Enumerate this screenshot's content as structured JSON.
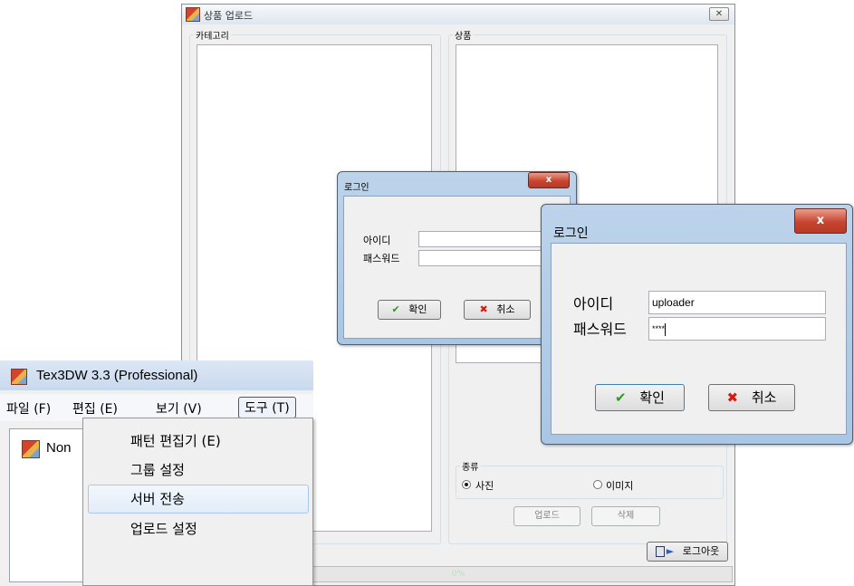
{
  "upload_window": {
    "title": "상품 업로드",
    "close_glyph": "✕",
    "category_label": "카테고리",
    "product_label": "상품",
    "type_group_label": "종류",
    "type_options": [
      "사진",
      "이미지"
    ],
    "type_selected": "사진",
    "upload_button": "업로드",
    "delete_button": "삭제",
    "logout_button": "로그아웃",
    "progress_text": "0%"
  },
  "login_small": {
    "title": "로그인",
    "id_label": "아이디",
    "pw_label": "패스워드",
    "ok_button": "확인",
    "cancel_button": "취소",
    "close_glyph": "x"
  },
  "login_large": {
    "title": "로그인",
    "id_label": "아이디",
    "id_value": "uploader",
    "pw_label": "패스워드",
    "pw_value": "****",
    "ok_button": "확인",
    "cancel_button": "취소",
    "close_glyph": "x"
  },
  "tex_app": {
    "title": "Tex3DW 3.3 (Professional)",
    "menu": [
      "파일 (F)",
      "편집 (E)",
      "보기 (V)",
      "도구 (T)"
    ],
    "active_menu": "도구 (T)",
    "tab_label": "Non",
    "tools_menu_items": [
      "패턴 편집기 (E)",
      "그룹 설정",
      "서버 전송",
      "업로드 설정"
    ],
    "highlighted_item": "서버 전송"
  },
  "colors": {
    "window_bg": "#f0f0f0",
    "dialog_frame": "#b4cde7",
    "close_red": "#c7452f",
    "check_green": "#2e9a1e",
    "cancel_red": "#d41e12",
    "menu_highlight": "#e2ecf8"
  },
  "icons": {
    "app": "tex3dw-app-icon",
    "ok": "check-icon",
    "cancel": "x-icon",
    "logout": "logout-door-icon"
  }
}
